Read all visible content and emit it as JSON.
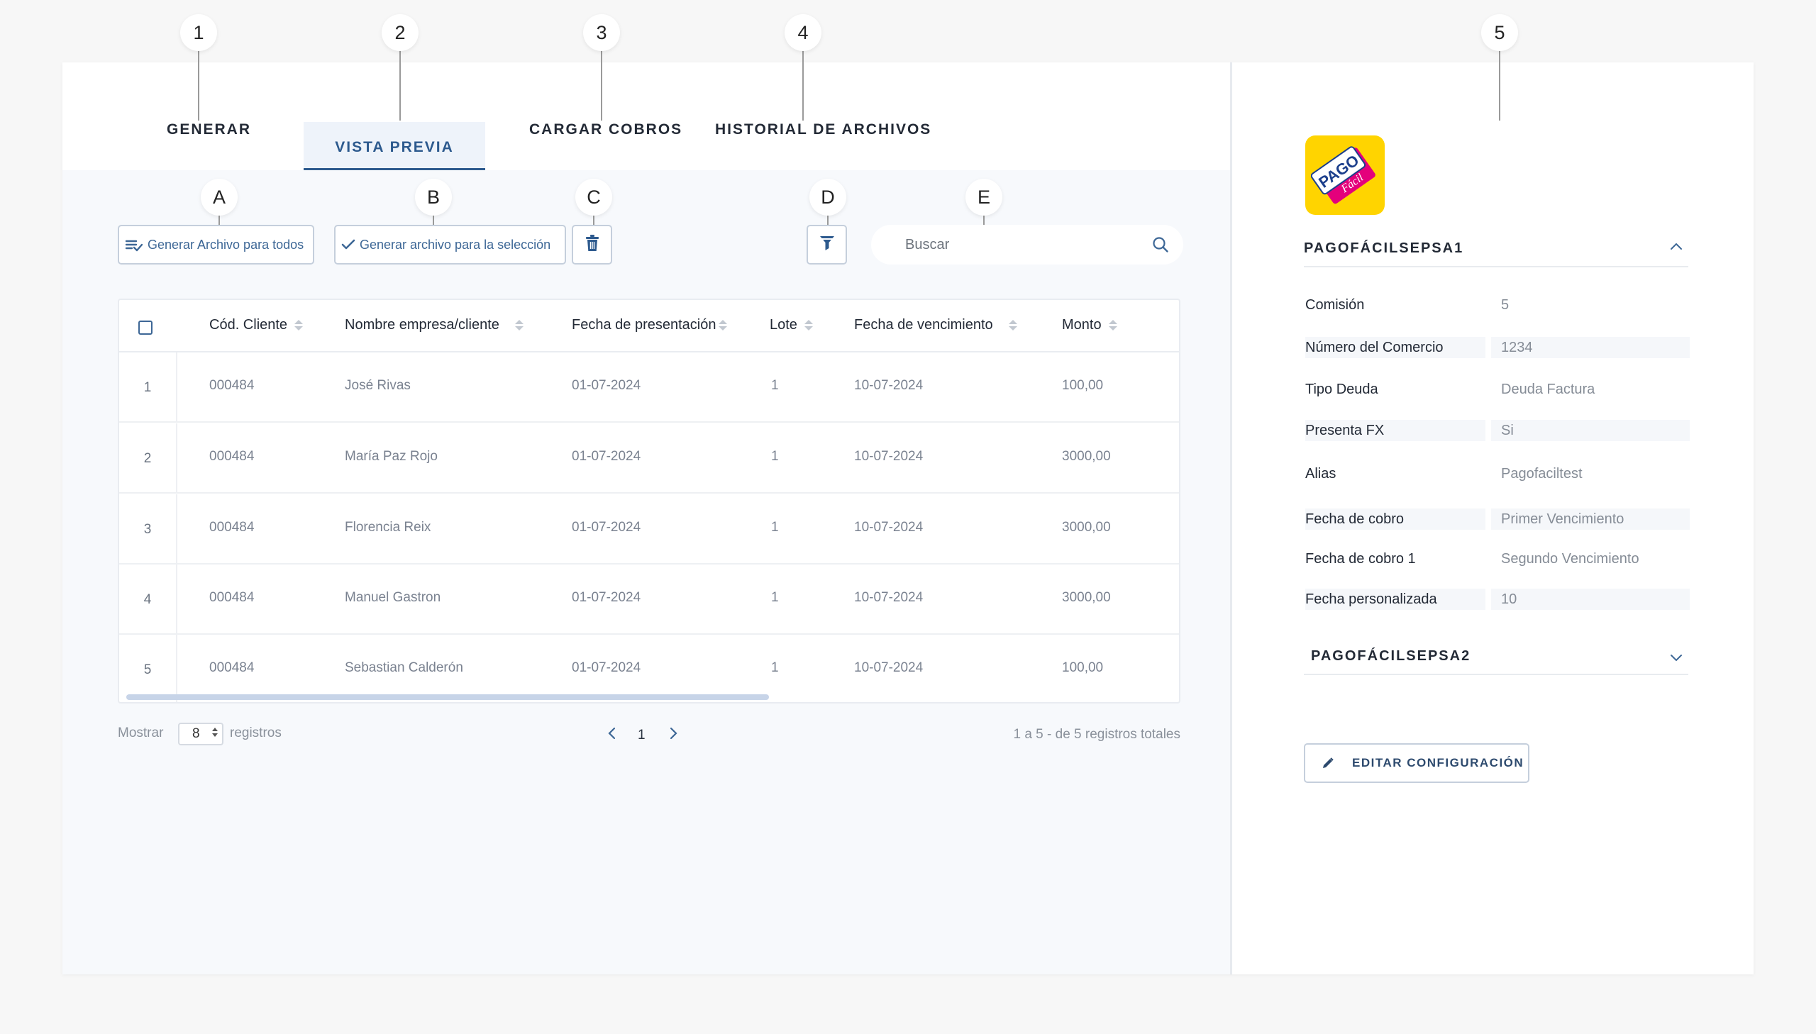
{
  "markers": {
    "m1": "1",
    "m2": "2",
    "m3": "3",
    "m4": "4",
    "m5": "5",
    "mA": "A",
    "mB": "B",
    "mC": "C",
    "mD": "D",
    "mE": "E"
  },
  "tabs": {
    "generar": "GENERAR",
    "vista_previa": "VISTA PREVIA",
    "cargar_cobros": "CARGAR COBROS",
    "historial": "HISTORIAL DE ARCHIVOS"
  },
  "toolbar": {
    "generate_all_label": "Generar Archivo para todos",
    "generate_selection_label": "Generar archivo para la selección",
    "delete_icon": "trash-icon",
    "filter_icon": "filter-icon",
    "search_placeholder": "Buscar"
  },
  "table": {
    "headers": {
      "cod_cliente": "Cód. Cliente",
      "nombre": "Nombre empresa/cliente",
      "fecha_presentacion": "Fecha de presentación",
      "lote": "Lote",
      "fecha_vencimiento": "Fecha de vencimiento",
      "monto": "Monto"
    },
    "rows": [
      {
        "n": "1",
        "cod": "000484",
        "nombre": "José Rivas",
        "fp": "01-07-2024",
        "lote": "1",
        "fv": "10-07-2024",
        "monto": "100,00"
      },
      {
        "n": "2",
        "cod": "000484",
        "nombre": "María Paz Rojo",
        "fp": "01-07-2024",
        "lote": "1",
        "fv": "10-07-2024",
        "monto": "3000,00"
      },
      {
        "n": "3",
        "cod": "000484",
        "nombre": "Florencia Reix",
        "fp": "01-07-2024",
        "lote": "1",
        "fv": "10-07-2024",
        "monto": "3000,00"
      },
      {
        "n": "4",
        "cod": "000484",
        "nombre": "Manuel Gastron",
        "fp": "01-07-2024",
        "lote": "1",
        "fv": "10-07-2024",
        "monto": "3000,00"
      },
      {
        "n": "5",
        "cod": "000484",
        "nombre": "Sebastian Calderón",
        "fp": "01-07-2024",
        "lote": "1",
        "fv": "10-07-2024",
        "monto": "100,00"
      }
    ]
  },
  "footer": {
    "mostrar": "Mostrar",
    "page_size": "8",
    "registros": "registros",
    "current_page": "1",
    "summary": "1 a 5 - de 5 registros totales"
  },
  "right_panel": {
    "logo_text": "PAGO",
    "logo_subtext": "Fácil",
    "section1_title": "PAGOFÁCILSEPSA1",
    "section2_title": "PAGOFÁCILSEPSA2",
    "props": [
      {
        "label": "Comisión",
        "value": "5"
      },
      {
        "label": "Número del Comercio",
        "value": "1234"
      },
      {
        "label": "Tipo Deuda",
        "value": "Deuda Factura"
      },
      {
        "label": "Presenta FX",
        "value": "Si"
      },
      {
        "label": "Alias",
        "value": "Pagofaciltest"
      },
      {
        "label": "Fecha de cobro",
        "value": "Primer Vencimiento"
      },
      {
        "label": "Fecha de cobro 1",
        "value": "Segundo Vencimiento"
      },
      {
        "label": "Fecha personalizada",
        "value": "10"
      }
    ],
    "edit_label": "EDITAR CONFIGURACIÓN"
  },
  "colors": {
    "accent": "#2d5a8e",
    "logo_yellow": "#ffd400",
    "logo_magenta": "#e4007c"
  }
}
